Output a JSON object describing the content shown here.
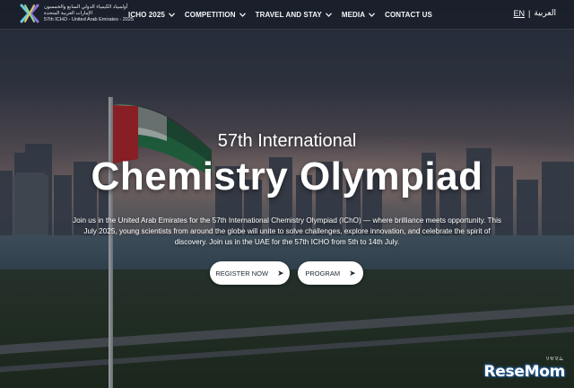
{
  "header": {
    "logo": {
      "arabic_line1": "أولمبياد الكيمياء الدولي السابع والخمسون",
      "arabic_line2": "الإمارات العربية المتحدة",
      "english_line": "57th ICHO - United Arab Emirates - 2025"
    },
    "nav": [
      {
        "label": "ICHO 2025",
        "icon": "chevron-down-icon"
      },
      {
        "label": "COMPETITION",
        "icon": "chevron-down-icon"
      },
      {
        "label": "TRAVEL AND STAY",
        "icon": "chevron-down-icon"
      },
      {
        "label": "MEDIA",
        "icon": "chevron-down-icon"
      },
      {
        "label": "CONTACT US"
      }
    ],
    "lang": {
      "en": "EN",
      "separator": "|",
      "ar": "العربية"
    }
  },
  "hero": {
    "subtitle": "57th International",
    "title": "Chemistry Olympiad",
    "description": "Join us in the United Arab Emirates for the 57th International Chemistry Olympiad (IChO) — where brilliance meets opportunity. This July 2025, young scientists from around the globe will unite to solve challenges, explore innovation, and celebrate the spirit of discovery. Join us in the UAE for the 57th ICHO from 5th to 14th July.",
    "buttons": [
      {
        "label": "REGISTER NOW",
        "icon": "arrow-right-icon",
        "arrow": "➤"
      },
      {
        "label": "PROGRAM",
        "icon": "arrow-right-icon",
        "arrow": "➤"
      }
    ]
  },
  "watermark": {
    "small": "リセマム",
    "logo": "ReseMom"
  },
  "colors": {
    "button_bg": "#ffffff",
    "button_text": "#1d2733",
    "flag_red": "#b8262c",
    "flag_green": "#1e7a45"
  }
}
